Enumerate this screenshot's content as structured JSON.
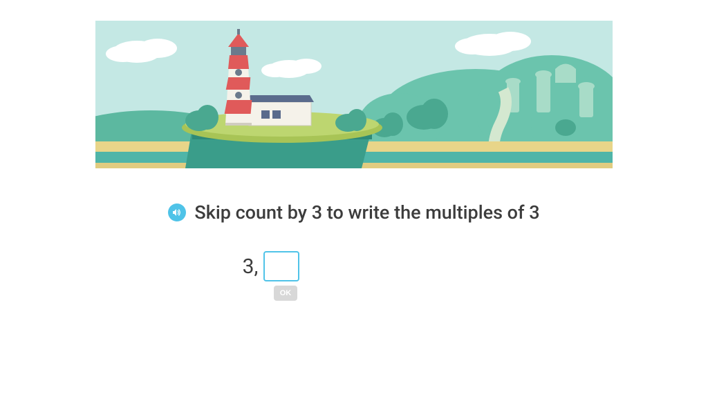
{
  "question": {
    "prompt": "Skip count by 3 to write the multiples of 3",
    "given_value": "3,",
    "input_value": "",
    "ok_label": "OK"
  },
  "scene": {
    "sky_color": "#c4e8e4",
    "water_color": "#4fb5a8",
    "sand_color": "#e8d589",
    "grass_color": "#a8c456",
    "hill_color": "#5cb8a0",
    "dark_hill": "#3a9d8a",
    "cloud_color": "#ffffff",
    "lighthouse_white": "#f5f2ea",
    "lighthouse_red": "#e05a5a",
    "roof_color": "#5a6b8c"
  }
}
